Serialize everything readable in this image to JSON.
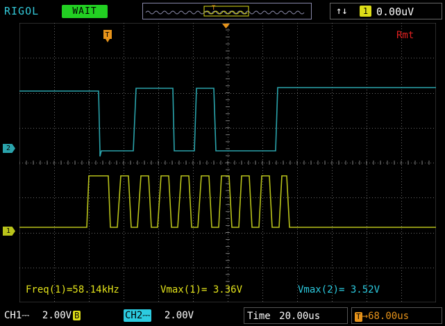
{
  "header": {
    "brand": "RIGOL",
    "run_status": "WAIT",
    "trigger_type_symbol": "↑↓",
    "trigger_source": "1",
    "trigger_level": "0.00uV"
  },
  "screen": {
    "trigger_marker": "T",
    "remote_indicator": "Rmt",
    "ch2_marker": "2",
    "ch1_marker": "1"
  },
  "measurements": {
    "freq_ch1": "Freq(1)=58.14kHz",
    "vmax_ch1": "Vmax(1)= 3.36V",
    "vmax_ch2": "Vmax(2)= 3.52V"
  },
  "footer": {
    "ch1_label": "CH1",
    "ch1_coupling": "⎓",
    "ch1_scale": "2.00V",
    "ch1_bw": "B",
    "ch2_label": "CH2",
    "ch2_coupling": "⎓",
    "ch2_scale": "2.00V",
    "time_label": "Time",
    "time_scale": "20.00us",
    "trig_offset_label": "T",
    "trig_offset_arrow": "→",
    "trig_offset": "68.00us"
  },
  "colors": {
    "ch1": "#b9c31a",
    "ch2": "#2aa4ac",
    "trigger": "#e8941a",
    "rmt": "#e02020",
    "status_bg": "#22d022",
    "measure_ch1": "#e3e31a",
    "measure_ch2": "#2ccbe0"
  }
}
